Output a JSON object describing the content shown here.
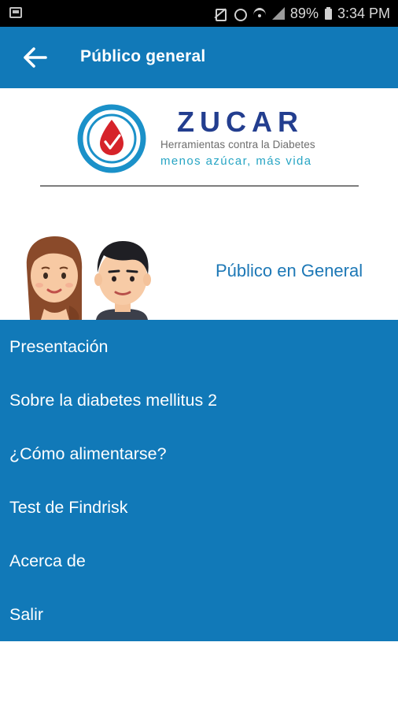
{
  "status_bar": {
    "battery": "89%",
    "time": "3:34 PM"
  },
  "app_bar": {
    "title": "Público general",
    "back_icon": "arrow-left-icon"
  },
  "brand": {
    "name": "ZUCAR",
    "tagline": "Herramientas contra la Diabetes",
    "slogan": "menos azúcar, más vida",
    "colors": {
      "navy": "#233e8f",
      "teal": "#27a5c4",
      "blood": "#d6232a"
    }
  },
  "header": {
    "audience_label": "Público en General"
  },
  "menu": {
    "background": "#1179b8",
    "items": [
      {
        "label": "Presentación"
      },
      {
        "label": "Sobre la diabetes mellitus 2"
      },
      {
        "label": "¿Cómo alimentarse?"
      },
      {
        "label": "Test de Findrisk"
      },
      {
        "label": "Acerca de"
      },
      {
        "label": "Salir"
      }
    ]
  }
}
